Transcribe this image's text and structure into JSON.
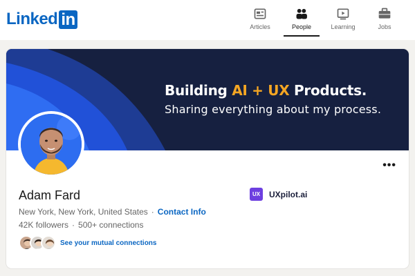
{
  "logo": {
    "text_linked": "Linked",
    "text_in": "in"
  },
  "nav": {
    "items": [
      {
        "label": "Articles",
        "icon": "articles-icon"
      },
      {
        "label": "People",
        "icon": "people-icon",
        "active": true
      },
      {
        "label": "Learning",
        "icon": "learning-icon"
      },
      {
        "label": "Jobs",
        "icon": "jobs-icon"
      }
    ]
  },
  "banner": {
    "line1_pre": "Building ",
    "line1_highlight": "AI + UX",
    "line1_post": " Products.",
    "line2": "Sharing everything about my process.",
    "highlight_color": "#f5a623",
    "background_color": "#162040"
  },
  "profile": {
    "name": "Adam Fard",
    "location": "New York, New York, United States",
    "contact_label": "Contact Info",
    "followers": "42K followers",
    "connections": "500+ connections",
    "mutual_label": "See your mutual connections",
    "more_label": "•••"
  },
  "company": {
    "logo_text": "UX",
    "name": "UXpilot.ai",
    "logo_color": "#6d3fe0"
  },
  "colors": {
    "brand": "#0a66c2"
  }
}
